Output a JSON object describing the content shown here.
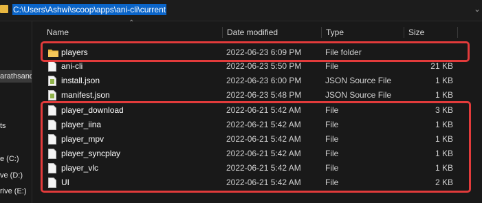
{
  "address": {
    "path": "C:\\Users\\Ashwi\\scoop\\apps\\ani-cli\\current",
    "folder_icon": "folder-icon",
    "chevron_icon": "chevron-down-icon"
  },
  "nav": {
    "items": [
      {
        "label": "arathsand",
        "selected": true
      },
      {
        "label": "ts",
        "selected": false
      },
      {
        "label": "e (C:)",
        "selected": false
      },
      {
        "label": "ve (D:)",
        "selected": false
      },
      {
        "label": "rive (E:)",
        "selected": false
      }
    ]
  },
  "columns": {
    "name": "Name",
    "date": "Date modified",
    "type": "Type",
    "size": "Size",
    "sort_icon": "sort-ascending-icon"
  },
  "files": [
    {
      "name": "players",
      "date": "2022-06-23 6:09 PM",
      "type": "File folder",
      "size": "",
      "icon": "folder-icon"
    },
    {
      "name": "ani-cli",
      "date": "2022-06-23 5:50 PM",
      "type": "File",
      "size": "21 KB",
      "icon": "file-icon"
    },
    {
      "name": "install.json",
      "date": "2022-06-23 6:00 PM",
      "type": "JSON Source File",
      "size": "1 KB",
      "icon": "json-file-icon"
    },
    {
      "name": "manifest.json",
      "date": "2022-06-23 5:48 PM",
      "type": "JSON Source File",
      "size": "1 KB",
      "icon": "json-file-icon"
    },
    {
      "name": "player_download",
      "date": "2022-06-21 5:42 AM",
      "type": "File",
      "size": "3 KB",
      "icon": "file-icon"
    },
    {
      "name": "player_iina",
      "date": "2022-06-21 5:42 AM",
      "type": "File",
      "size": "1 KB",
      "icon": "file-icon"
    },
    {
      "name": "player_mpv",
      "date": "2022-06-21 5:42 AM",
      "type": "File",
      "size": "1 KB",
      "icon": "file-icon"
    },
    {
      "name": "player_syncplay",
      "date": "2022-06-21 5:42 AM",
      "type": "File",
      "size": "1 KB",
      "icon": "file-icon"
    },
    {
      "name": "player_vlc",
      "date": "2022-06-21 5:42 AM",
      "type": "File",
      "size": "1 KB",
      "icon": "file-icon"
    },
    {
      "name": "UI",
      "date": "2022-06-21 5:42 AM",
      "type": "File",
      "size": "2 KB",
      "icon": "file-icon"
    }
  ],
  "colors": {
    "background": "#191919",
    "highlight_box": "#e23b3b",
    "selection": "#0a64c8",
    "folder": "#e8b740"
  }
}
